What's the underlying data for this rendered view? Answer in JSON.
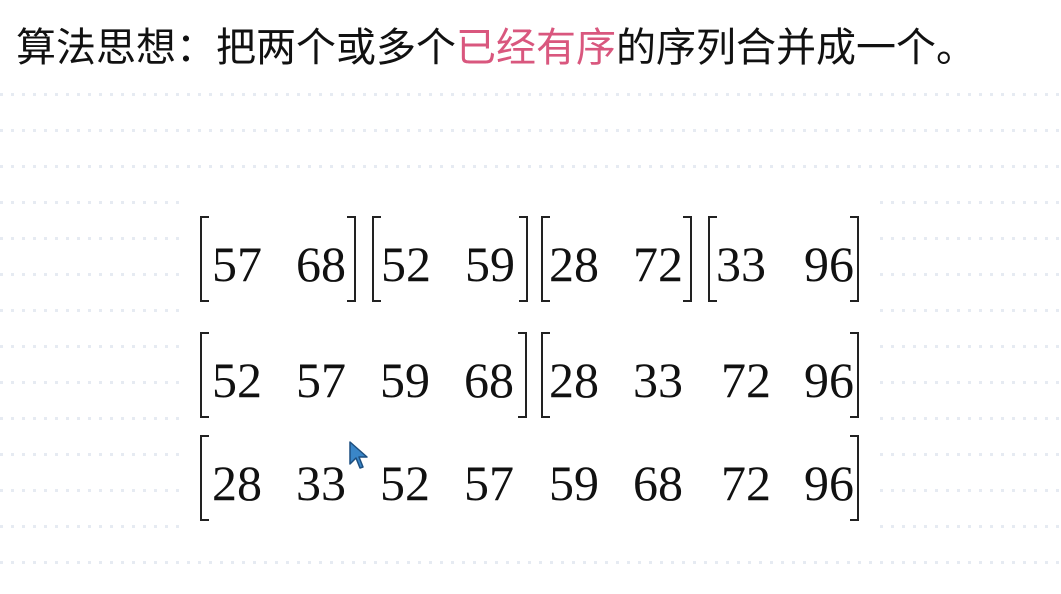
{
  "title": {
    "prefix": "算法思想：把两个或多个",
    "highlight": "已经有序",
    "suffix": "的序列合并成一个。"
  },
  "colors": {
    "highlight": "#d9577e",
    "text": "#111111",
    "bracket": "#222222"
  },
  "rows": [
    {
      "groups": [
        {
          "values": [
            "57",
            "68"
          ]
        },
        {
          "values": [
            "52",
            "59"
          ]
        },
        {
          "values": [
            "28",
            "72"
          ]
        },
        {
          "values": [
            "33",
            "96"
          ]
        }
      ]
    },
    {
      "groups": [
        {
          "values": [
            "52",
            "57",
            "59",
            "68"
          ]
        },
        {
          "values": [
            "28",
            "33",
            "72",
            "96"
          ]
        }
      ]
    },
    {
      "groups": [
        {
          "values": [
            "28",
            "33",
            "52",
            "57",
            "59",
            "68",
            "72",
            "96"
          ]
        }
      ]
    }
  ],
  "icons": {
    "cursor": "mouse-pointer-icon"
  }
}
